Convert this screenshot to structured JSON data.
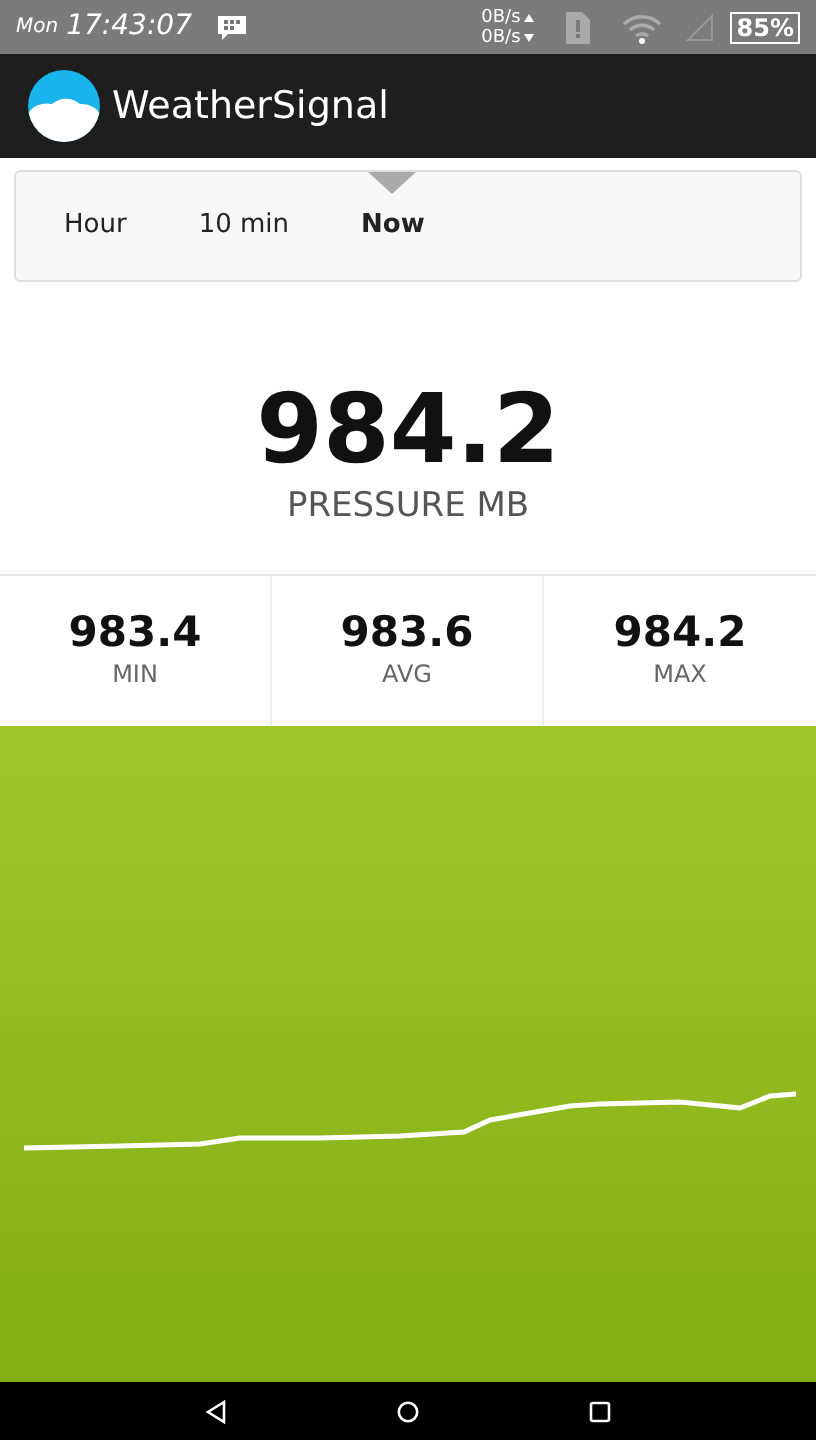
{
  "status_bar": {
    "day": "Mon",
    "time": "17:43:07",
    "upload": "0B/s",
    "download": "0B/s",
    "battery": "85%"
  },
  "app_bar": {
    "title": "WeatherSignal"
  },
  "tabs": [
    {
      "label": "Hour",
      "selected": false
    },
    {
      "label": "10 min",
      "selected": false
    },
    {
      "label": "Now",
      "selected": true
    }
  ],
  "reading": {
    "value": "984.2",
    "label": "PRESSURE MB"
  },
  "stats": [
    {
      "value": "983.4",
      "label": "MIN"
    },
    {
      "value": "983.6",
      "label": "AVG"
    },
    {
      "value": "984.2",
      "label": "MAX"
    }
  ]
}
